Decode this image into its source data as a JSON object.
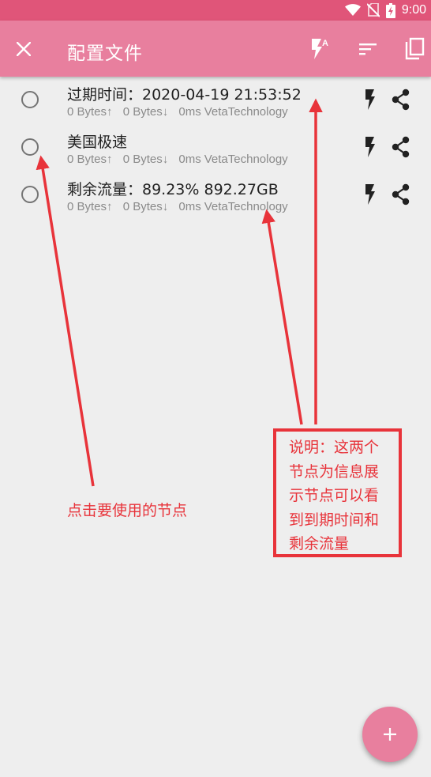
{
  "status_bar": {
    "time": "9:00",
    "icons": [
      "wifi-icon",
      "no-sim-icon",
      "battery-charging-icon"
    ],
    "color": "#e05579"
  },
  "app_bar": {
    "title": "配置文件",
    "close_icon": "close-icon",
    "actions": [
      "lightning-auto-icon",
      "sort-icon",
      "copy-icon"
    ],
    "color": "#e87f9e"
  },
  "profiles": [
    {
      "title": "过期时间：2020-04-19 21:53:52",
      "upload": "0 Bytes↑",
      "download": "0 Bytes↓",
      "latency": "0ms",
      "source": "VetaTechnology",
      "selected": false
    },
    {
      "title": "美国极速",
      "upload": "0 Bytes↑",
      "download": "0 Bytes↓",
      "latency": "0ms",
      "source": "VetaTechnology",
      "selected": false
    },
    {
      "title": "剩余流量：89.23% 892.27GB",
      "upload": "0 Bytes↑",
      "download": "0 Bytes↓",
      "latency": "0ms",
      "source": "VetaTechnology",
      "selected": false
    }
  ],
  "annotations": {
    "note": "说明：这两个节点为信息展示节点可以看到到期时间和剩余流量",
    "hint": "点击要使用的节点",
    "color": "#e8333a"
  },
  "fab": {
    "label": "+",
    "icon": "plus-icon"
  }
}
